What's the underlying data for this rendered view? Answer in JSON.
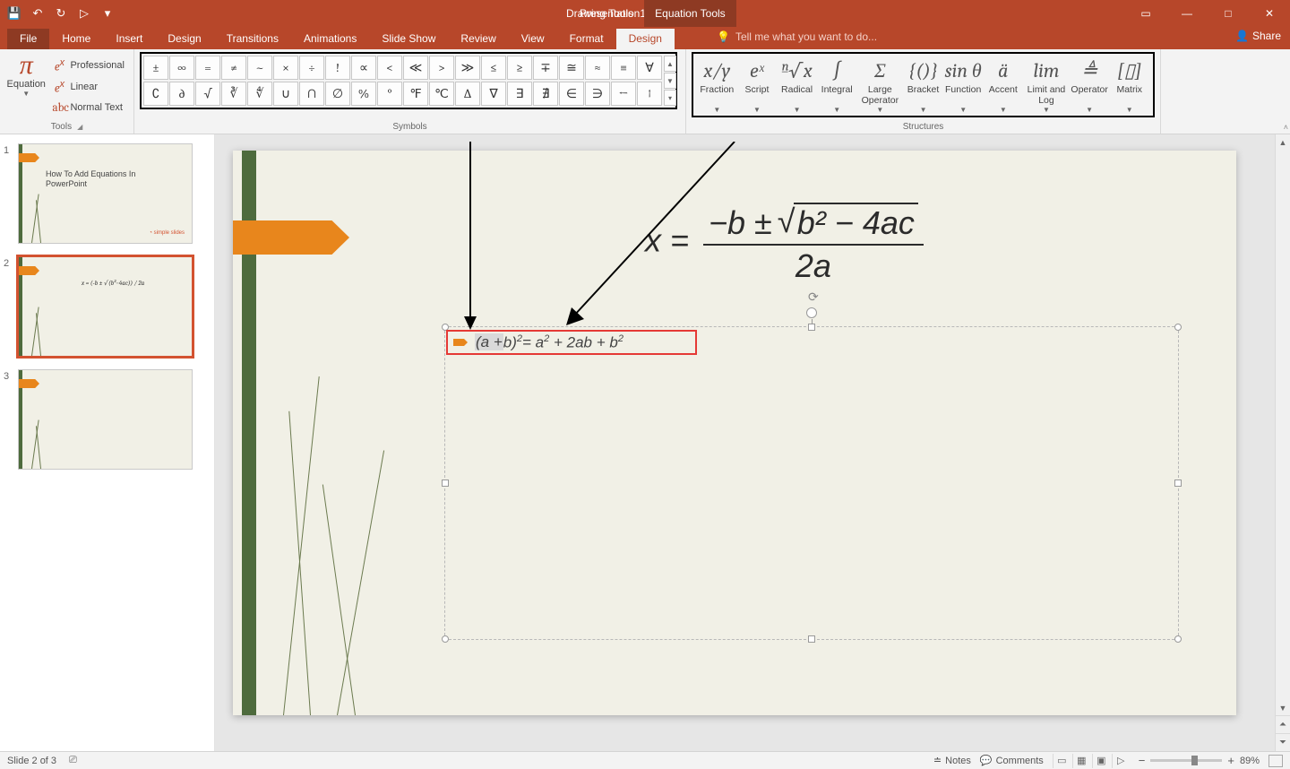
{
  "title": "Presentation1 - PowerPoint",
  "qat": {
    "save": "💾",
    "undo": "↶",
    "redo": "↻",
    "start": "▷",
    "more": "▾"
  },
  "tool_tabs": {
    "drawing": "Drawing Tools",
    "equation": "Equation Tools"
  },
  "win": {
    "ribbon_opts": "▭",
    "min": "—",
    "max": "□",
    "close": "✕"
  },
  "tabs": {
    "file": "File",
    "home": "Home",
    "insert": "Insert",
    "design_main": "Design",
    "transitions": "Transitions",
    "animations": "Animations",
    "slideshow": "Slide Show",
    "review": "Review",
    "view": "View",
    "format": "Format",
    "design": "Design"
  },
  "tellme": {
    "icon": "💡",
    "text": "Tell me what you want to do..."
  },
  "share": {
    "icon": "👤",
    "label": "Share"
  },
  "ribbon": {
    "tools": {
      "equation": "Equation",
      "professional": "Professional",
      "linear": "Linear",
      "normal": "Normal Text",
      "label": "Tools"
    },
    "symbols": {
      "label": "Symbols",
      "row1": [
        "±",
        "∞",
        "=",
        "≠",
        "~",
        "×",
        "÷",
        "!",
        "∝",
        "<",
        "≪",
        ">",
        "≫",
        "≤",
        "≥",
        "∓",
        "≅",
        "≈",
        "≡",
        "∀"
      ],
      "row2": [
        "∁",
        "∂",
        "√",
        "∛",
        "∜",
        "∪",
        "∩",
        "∅",
        "%",
        "°",
        "℉",
        "℃",
        "∆",
        "∇",
        "∃",
        "∄",
        "∈",
        "∋",
        "←",
        "↑"
      ]
    },
    "structures": {
      "label": "Structures",
      "items": [
        {
          "icon": "x/y",
          "label": "Fraction"
        },
        {
          "icon": "eˣ",
          "label": "Script"
        },
        {
          "icon": "ⁿ√x",
          "label": "Radical"
        },
        {
          "icon": "∫",
          "label": "Integral"
        },
        {
          "icon": "Σ",
          "label": "Large Operator"
        },
        {
          "icon": "{()}",
          "label": "Bracket"
        },
        {
          "icon": "sin θ",
          "label": "Function"
        },
        {
          "icon": "ä",
          "label": "Accent"
        },
        {
          "icon": "lim",
          "label": "Limit and Log"
        },
        {
          "icon": "≜",
          "label": "Operator"
        },
        {
          "icon": "[▯]",
          "label": "Matrix"
        }
      ]
    }
  },
  "slides": {
    "s1": {
      "num": "1",
      "title": "How To Add Equations In PowerPoint",
      "logo": "◔ simple slides"
    },
    "s2": {
      "num": "2",
      "eq": "x = (-b ± √(b²−4ac)) / 2a"
    },
    "s3": {
      "num": "3"
    }
  },
  "canvas": {
    "big_eq": {
      "lhs": "x =",
      "num_a": "−b ±",
      "rad": "b² − 4ac",
      "den": "2a"
    },
    "small_eq": {
      "sel": "(a +",
      "rest_lhs": "b)",
      "sup1": "2",
      "eq": "= a",
      "sup2": "2",
      "mid": " + 2ab + b",
      "sup3": "2"
    }
  },
  "status": {
    "slide": "Slide 2 of 3",
    "lang_icon": "⎚",
    "notes": "Notes",
    "comments": "Comments",
    "zoom_pct": "89%"
  }
}
